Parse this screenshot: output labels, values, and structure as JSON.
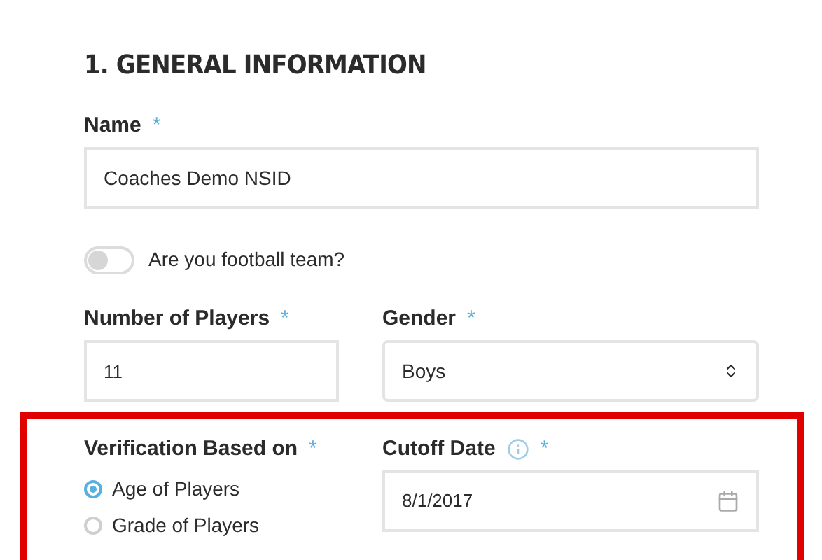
{
  "heading": "1. GENERAL INFORMATION",
  "name_field": {
    "label": "Name",
    "required_mark": "*",
    "value": "Coaches Demo NSID"
  },
  "football_toggle": {
    "label": "Are you football team?",
    "on": false
  },
  "players_field": {
    "label": "Number of Players",
    "required_mark": "*",
    "value": "11"
  },
  "gender_field": {
    "label": "Gender",
    "required_mark": "*",
    "value": "Boys"
  },
  "verification": {
    "label": "Verification Based on",
    "required_mark": "*",
    "options": [
      {
        "label": "Age of Players",
        "selected": true
      },
      {
        "label": "Grade of Players",
        "selected": false
      }
    ]
  },
  "cutoff_field": {
    "label": "Cutoff Date",
    "required_mark": "*",
    "value": "8/1/2017"
  }
}
